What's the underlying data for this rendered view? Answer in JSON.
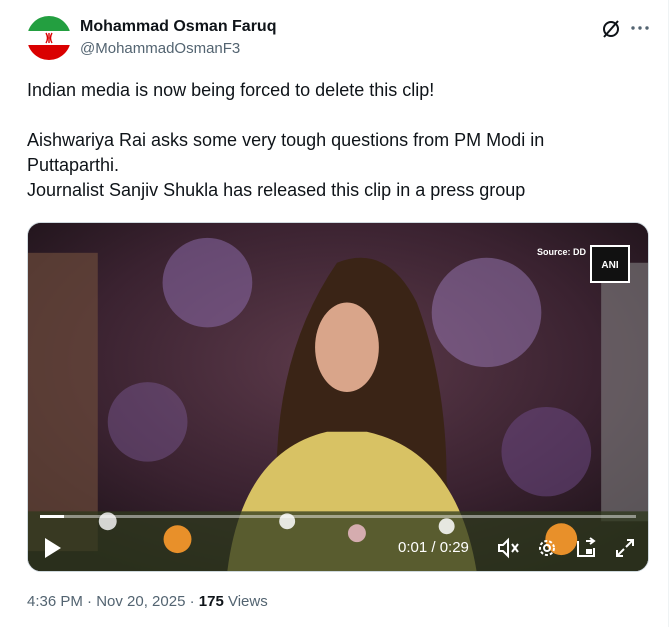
{
  "author": {
    "name": "Mohammad Osman Faruq",
    "handle": "@MohammadOsmanF3"
  },
  "post": {
    "text": "Indian media is now being forced to delete this clip!\n\nAishwariya Rai asks some very tough questions from PM Modi in Puttaparthi.\nJournalist Sanjiv Shukla has released this clip in a press group"
  },
  "media": {
    "source_label": "Source: DD",
    "watermark": "ANI",
    "time": "0:01 / 0:29",
    "progress": 0.04
  },
  "meta": {
    "datetime": "4:36 PM · Nov 20, 2025 ·",
    "views_count": "175",
    "views_label": "Views"
  },
  "icons": {
    "grok": "grok-icon",
    "more": "more-icon",
    "play": "play-icon",
    "volume": "volume-muted-icon",
    "settings": "gear-icon",
    "pip": "picture-in-picture-icon",
    "fullscreen": "fullscreen-icon"
  }
}
